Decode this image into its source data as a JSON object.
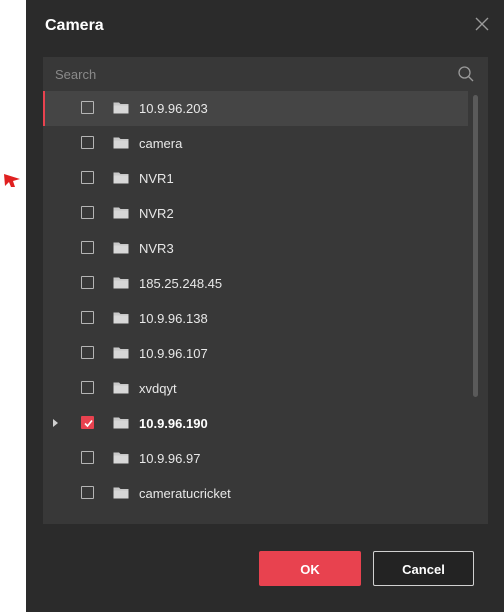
{
  "dialog": {
    "title": "Camera",
    "ok_label": "OK",
    "cancel_label": "Cancel"
  },
  "search": {
    "placeholder": "Search",
    "value": ""
  },
  "tree": {
    "items": [
      {
        "label": "10.9.96.203",
        "checked": false,
        "selected": true,
        "expandable": false
      },
      {
        "label": "camera",
        "checked": false,
        "selected": false,
        "expandable": false
      },
      {
        "label": "NVR1",
        "checked": false,
        "selected": false,
        "expandable": false
      },
      {
        "label": "NVR2",
        "checked": false,
        "selected": false,
        "expandable": false
      },
      {
        "label": "NVR3",
        "checked": false,
        "selected": false,
        "expandable": false
      },
      {
        "label": "185.25.248.45",
        "checked": false,
        "selected": false,
        "expandable": false
      },
      {
        "label": "10.9.96.138",
        "checked": false,
        "selected": false,
        "expandable": false
      },
      {
        "label": "10.9.96.107",
        "checked": false,
        "selected": false,
        "expandable": false
      },
      {
        "label": "xvdqyt",
        "checked": false,
        "selected": false,
        "expandable": false
      },
      {
        "label": "10.9.96.190",
        "checked": true,
        "selected": false,
        "expandable": true
      },
      {
        "label": "10.9.96.97",
        "checked": false,
        "selected": false,
        "expandable": false
      },
      {
        "label": "cameratucricket",
        "checked": false,
        "selected": false,
        "expandable": false
      }
    ]
  },
  "colors": {
    "accent": "#e8424f",
    "dialog_bg": "#2b2b2b",
    "panel_bg": "#383838",
    "highlight_bg": "#454545"
  },
  "icons": {
    "close": "close-icon",
    "search": "search-icon",
    "folder": "folder-icon",
    "checkmark": "checkmark-icon",
    "expand": "expand-arrow-icon"
  }
}
